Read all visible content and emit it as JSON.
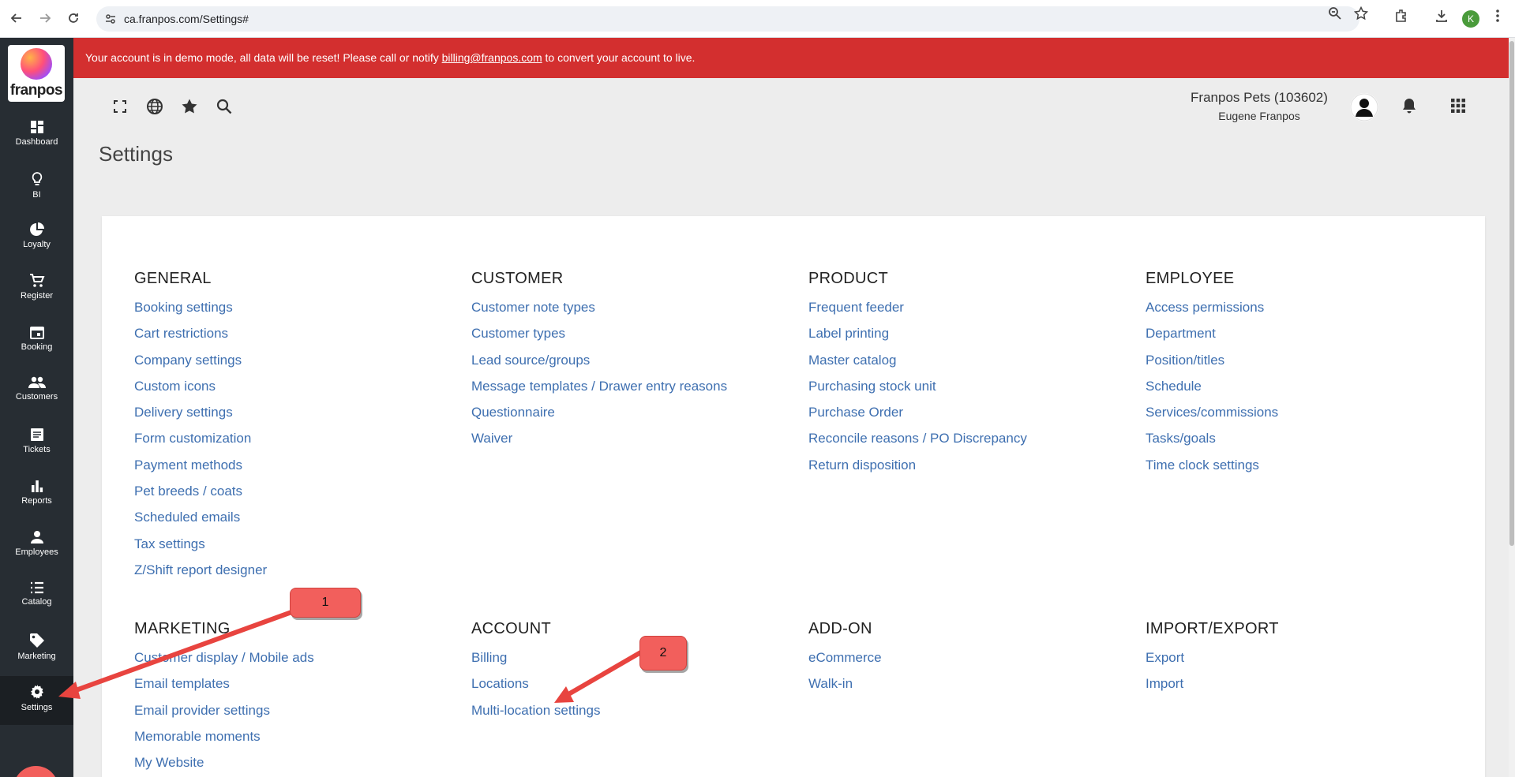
{
  "browser": {
    "url": "ca.franpos.com/Settings#",
    "profile_initial": "K"
  },
  "sidebar": {
    "logo_text": "franpos",
    "items": [
      {
        "label": "Dashboard",
        "icon": "dashboard-icon"
      },
      {
        "label": "BI",
        "icon": "lightbulb-icon"
      },
      {
        "label": "Loyalty",
        "icon": "pie-chart-icon"
      },
      {
        "label": "Register",
        "icon": "cart-icon"
      },
      {
        "label": "Booking",
        "icon": "calendar-icon"
      },
      {
        "label": "Customers",
        "icon": "people-icon"
      },
      {
        "label": "Tickets",
        "icon": "ticket-icon"
      },
      {
        "label": "Reports",
        "icon": "bar-chart-icon"
      },
      {
        "label": "Employees",
        "icon": "person-icon"
      },
      {
        "label": "Catalog",
        "icon": "list-icon"
      },
      {
        "label": "Marketing",
        "icon": "tag-icon"
      },
      {
        "label": "Settings",
        "icon": "gear-icon"
      }
    ],
    "help_label": "?"
  },
  "banner": {
    "text_before": "Your account is in demo mode, all data will be reset! Please call or notify ",
    "email": "billing@franpos.com",
    "text_after": " to convert your account to live."
  },
  "header": {
    "tenant_name": "Franpos Pets (103602)",
    "user_name": "Eugene Franpos"
  },
  "page": {
    "title": "Settings"
  },
  "sections": {
    "general": {
      "title": "GENERAL",
      "links": [
        "Booking settings",
        "Cart restrictions",
        "Company settings",
        "Custom icons",
        "Delivery settings",
        "Form customization",
        "Payment methods",
        "Pet breeds / coats",
        "Scheduled emails",
        "Tax settings",
        "Z/Shift report designer"
      ]
    },
    "customer": {
      "title": "CUSTOMER",
      "links": [
        "Customer note types",
        "Customer types",
        "Lead source/groups",
        "Message templates / Drawer entry reasons",
        "Questionnaire",
        "Waiver"
      ]
    },
    "product": {
      "title": "PRODUCT",
      "links": [
        "Frequent feeder",
        "Label printing",
        "Master catalog",
        "Purchasing stock unit",
        "Purchase Order",
        "Reconcile reasons / PO Discrepancy",
        "Return disposition"
      ]
    },
    "employee": {
      "title": "EMPLOYEE",
      "links": [
        "Access permissions",
        "Department",
        "Position/titles",
        "Schedule",
        "Services/commissions",
        "Tasks/goals",
        "Time clock settings"
      ]
    },
    "marketing": {
      "title": "MARKETING",
      "links": [
        "Customer display / Mobile ads",
        "Email templates",
        "Email provider settings",
        "Memorable moments",
        "My Website"
      ]
    },
    "account": {
      "title": "ACCOUNT",
      "links": [
        "Billing",
        "Locations",
        "Multi-location settings"
      ]
    },
    "addon": {
      "title": "ADD-ON",
      "links": [
        "eCommerce",
        "Walk-in"
      ]
    },
    "importexport": {
      "title": "IMPORT/EXPORT",
      "links": [
        "Export",
        "Import"
      ]
    }
  },
  "callouts": {
    "one": "1",
    "two": "2"
  }
}
